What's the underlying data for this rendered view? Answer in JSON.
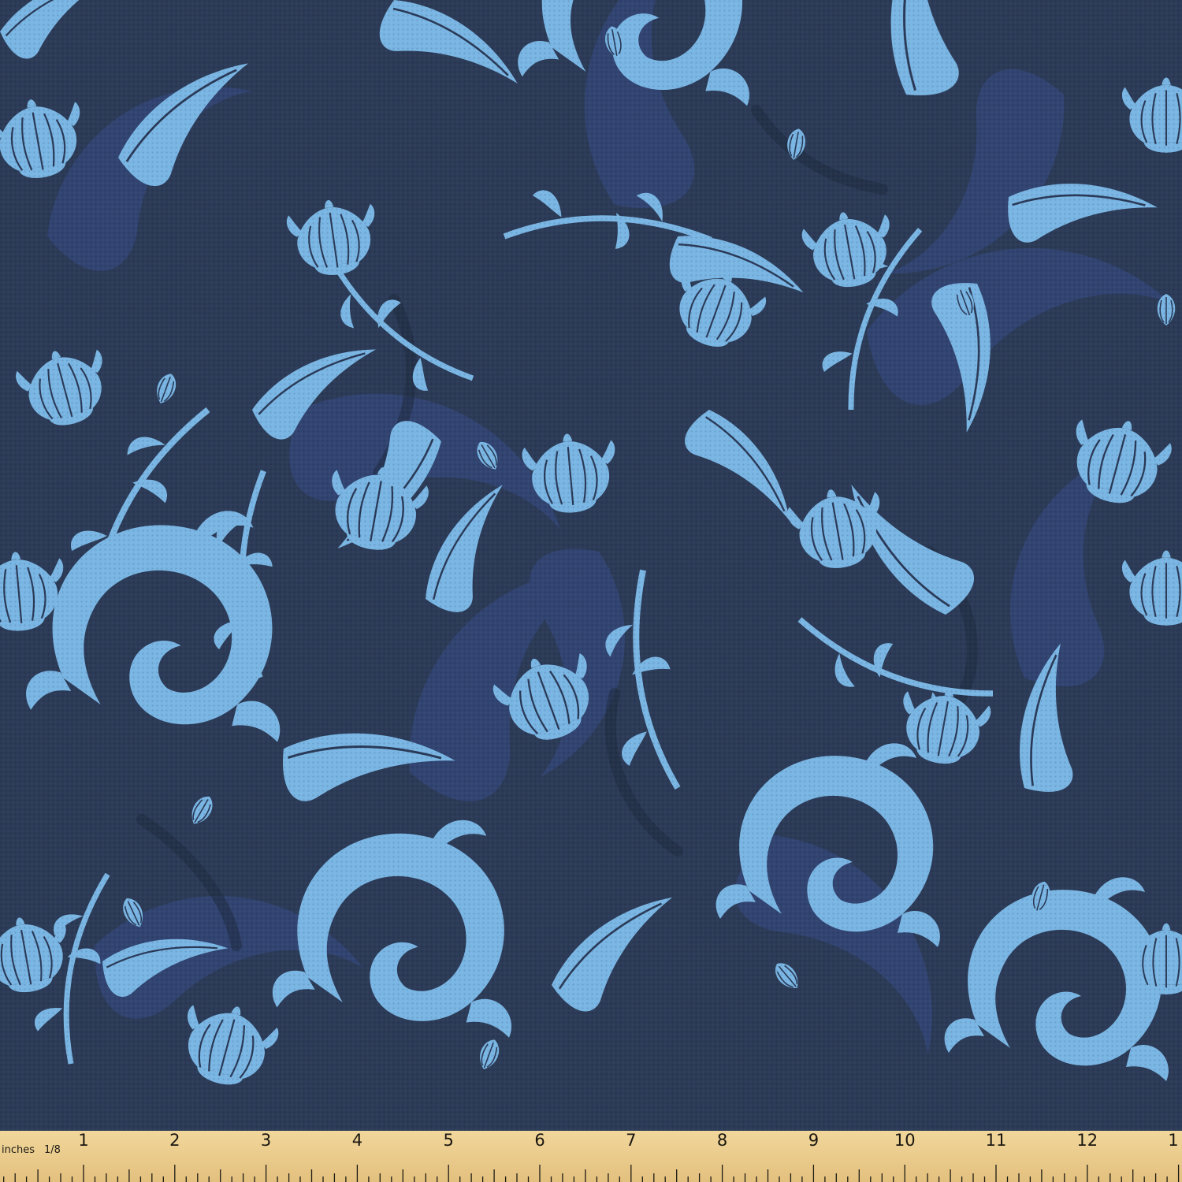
{
  "image": {
    "subject": "blue floral fabric swatch with measuring ruler",
    "palette": {
      "background": "#2c3b57",
      "background_dark": "#1f2b40",
      "shadow_layer": "#34497a",
      "motif_light": "#7ab6e4",
      "motif_line": "#2a3a58",
      "ruler_wood": "#e8c98a",
      "ruler_ink": "#1e1a14"
    }
  },
  "ruler": {
    "unit_label": "inches",
    "fraction_label": "1/8",
    "numbers": [
      "1",
      "2",
      "3",
      "4",
      "5",
      "6",
      "7",
      "8",
      "9",
      "10",
      "11",
      "12",
      "1"
    ]
  }
}
